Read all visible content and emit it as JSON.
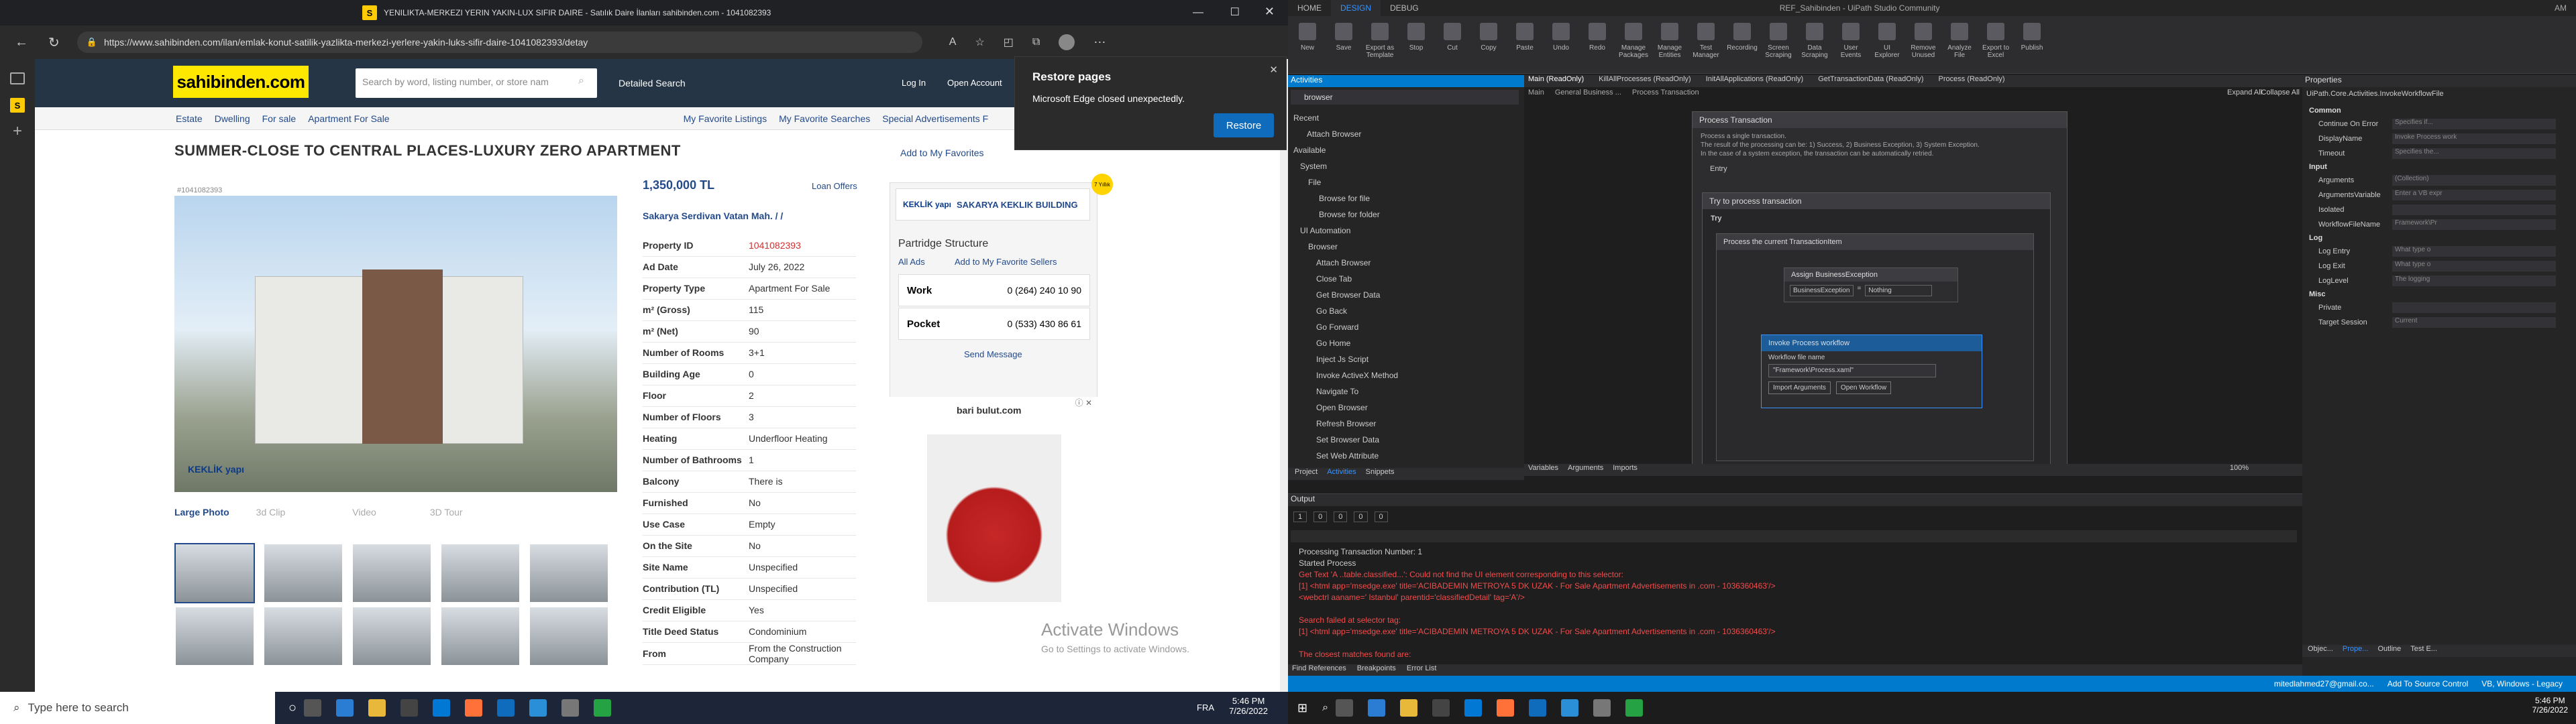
{
  "browser": {
    "tab_title": "YENILIKTA-MERKEZI YERIN YAKIN-LUX SIFIR DAIRE - Satılık Daire İlanları sahibinden.com - 1041082393",
    "url": "https://www.sahibinden.com/ilan/emlak-konut-satilik-yazlikta-merkezi-yerlere-yakin-luks-sifir-daire-1041082393/detay",
    "restore_title": "Restore pages",
    "restore_message": "Microsoft Edge closed unexpectedly.",
    "restore_button": "Restore"
  },
  "site": {
    "logo": "sahibinden.com",
    "search_placeholder": "Search by word, listing number, or store nam",
    "detailed_search": "Detailed Search",
    "login": "Log In",
    "open_account": "Open Account",
    "breadcrumbs": [
      "Estate",
      "Dwelling",
      "For sale",
      "Apartment For Sale"
    ],
    "right_links": [
      "My Favorite Listings",
      "My Favorite Searches",
      "Special Advertisements F"
    ],
    "title": "SUMMER-CLOSE TO CENTRAL PLACES-LUXURY ZERO APARTMENT",
    "add_favorites": "Add to My Favorites",
    "listing_no": "#1041082393",
    "price": "1,350,000 TL",
    "loan_offers": "Loan Offers",
    "location": "Sakarya Serdivan Vatan Mah. / /",
    "details": [
      {
        "k": "Property ID",
        "v": "1041082393"
      },
      {
        "k": "Ad Date",
        "v": "July 26, 2022"
      },
      {
        "k": "Property Type",
        "v": "Apartment For Sale"
      },
      {
        "k": "m² (Gross)",
        "v": "115"
      },
      {
        "k": "m² (Net)",
        "v": "90"
      },
      {
        "k": "Number of Rooms",
        "v": "3+1"
      },
      {
        "k": "Building Age",
        "v": "0"
      },
      {
        "k": "Floor",
        "v": "2"
      },
      {
        "k": "Number of Floors",
        "v": "3"
      },
      {
        "k": "Heating",
        "v": "Underfloor Heating"
      },
      {
        "k": "Number of Bathrooms",
        "v": "1"
      },
      {
        "k": "Balcony",
        "v": "There is"
      },
      {
        "k": "Furnished",
        "v": "No"
      },
      {
        "k": "Use Case",
        "v": "Empty"
      },
      {
        "k": "On the Site",
        "v": "No"
      },
      {
        "k": "Site Name",
        "v": "Unspecified"
      },
      {
        "k": "Contribution (TL)",
        "v": "Unspecified"
      },
      {
        "k": "Credit Eligible",
        "v": "Yes"
      },
      {
        "k": "Title Deed Status",
        "v": "Condominium"
      },
      {
        "k": "From",
        "v": "From the Construction Company"
      }
    ],
    "store_name": "SAKARYA KEKLIK BUILDING",
    "store_logo": "KEKLİK yapı",
    "store_badge": "7 Yıllık",
    "agency": "Partridge Structure",
    "all_ads": "All Ads",
    "add_fav_sellers": "Add to My Favorite Sellers",
    "work_label": "Work",
    "work_phone": "0 (264) 240 10 90",
    "pocket_label": "Pocket",
    "pocket_phone": "0 (533) 430 86 61",
    "send_message": "Send Message",
    "photo_tabs": [
      "Large Photo",
      "3d Clip",
      "Video",
      "3D Tour"
    ],
    "ad_brand": "bari bulut.com",
    "watermark_1": "Activate Windows",
    "watermark_2": "Go to Settings to activate Windows."
  },
  "taskbar_left": {
    "search": "Type here to search",
    "time": "5:46 PM",
    "date": "7/26/2022",
    "lang": "FRA"
  },
  "uipath": {
    "title": "REF_Sahibinden - UiPath Studio Community",
    "tabs": [
      "HOME",
      "DESIGN",
      "DEBUG"
    ],
    "ribbon": [
      "New",
      "Save",
      "Export as Template",
      "Stop",
      "Cut",
      "Copy",
      "Paste",
      "Undo",
      "Redo",
      "Manage Packages",
      "Manage Entities",
      "Test Manager",
      "Recording",
      "Screen Scraping",
      "Data Scraping",
      "User Events",
      "UI Explorer",
      "Remove Unused",
      "Analyze File",
      "Export to Excel",
      "Publish"
    ],
    "activities_title": "Activities",
    "activities_search": "browser",
    "tree": [
      "Recent",
      "Attach Browser",
      "Available",
      "System",
      "File",
      "Browse for file",
      "Browse for folder",
      "UI Automation",
      "Browser",
      "Attach Browser",
      "Close Tab",
      "Get Browser Data",
      "Go Back",
      "Go Forward",
      "Go Home",
      "Inject Js Script",
      "Invoke ActiveX Method",
      "Navigate To",
      "Open Browser",
      "Refresh Browser",
      "Set Browser Data",
      "Set Web Attribute"
    ],
    "doc_tabs": [
      "Main (ReadOnly)",
      "KillAllProcesses (ReadOnly)",
      "InitAllApplications (ReadOnly)",
      "GetTransactionData (ReadOnly)",
      "Process (ReadOnly)"
    ],
    "designer_crumbs": [
      "Main",
      "General Business ...",
      "Process Transaction"
    ],
    "expand_all": "Expand All",
    "collapse_all": "Collapse All",
    "process_transaction": "Process Transaction",
    "pt_desc_1": "Process a single transaction.",
    "pt_desc_2": "The result of the processing can be: 1) Success, 2) Business Exception, 3) System Exception.",
    "pt_desc_3": "In the case of a system exception, the transaction can be automatically retried.",
    "entry": "Entry",
    "try_process": "Try to process transaction",
    "try": "Try",
    "process_current": "Process the current TransactionItem",
    "assign_be": "Assign BusinessException",
    "be_var": "BusinessException",
    "be_val": "Nothing",
    "invoke_title": "Invoke Process workflow",
    "workflow_label": "Workflow file name",
    "workflow_value": "\"Framework\\Process.xaml\"",
    "import_args": "Import Arguments",
    "open_workflow": "Open Workflow",
    "designer_bottom": [
      "Variables",
      "Arguments",
      "Imports"
    ],
    "zoom": "100%",
    "left_bottom_tabs": [
      "Project",
      "Activities",
      "Snippets"
    ],
    "output_title": "Output",
    "output_counts": [
      "1",
      "0",
      "0",
      "0",
      "0"
    ],
    "output_lines": [
      {
        "t": "Processing Transaction Number: 1",
        "c": "#ccc"
      },
      {
        "t": "Started Process",
        "c": "#ccc"
      },
      {
        "t": "Get Text 'A ..table.classified...': Could not find the UI element corresponding to this selector:",
        "c": "#f14c4c"
      },
      {
        "t": "[1] <html app='msedge.exe' title='ACIBADEMIN METROYA 5 DK UZAK - For Sale Apartment Advertisements in .com - 1036360463'/>",
        "c": "#f14c4c"
      },
      {
        "t": "<webctrl aaname=' Istanbul' parentid='classifiedDetail' tag='A'/>",
        "c": "#f14c4c"
      },
      {
        "t": "",
        "c": "#ccc"
      },
      {
        "t": "Search failed at selector tag:",
        "c": "#f14c4c"
      },
      {
        "t": "[1] <html app='msedge.exe' title='ACIBADEMIN METROYA 5 DK UZAK - For Sale Apartment Advertisements in .com - 1036360463'/>",
        "c": "#f14c4c"
      },
      {
        "t": "",
        "c": "#ccc"
      },
      {
        "t": "The closest matches found are:",
        "c": "#f14c4c"
      }
    ],
    "output_tabs": [
      "Find References",
      "Breakpoints",
      "Error List"
    ],
    "properties_title": "Properties",
    "properties_type": "UiPath.Core.Activities.InvokeWorkflowFile",
    "prop_groups": [
      {
        "name": "Common",
        "rows": [
          {
            "k": "Continue On Error",
            "v": "Specifies if..."
          },
          {
            "k": "DisplayName",
            "v": "Invoke Process work"
          },
          {
            "k": "Timeout",
            "v": "Specifies the..."
          }
        ]
      },
      {
        "name": "Input",
        "rows": [
          {
            "k": "Arguments",
            "v": "(Collection)"
          },
          {
            "k": "ArgumentsVariable",
            "v": "Enter a VB expr"
          },
          {
            "k": "Isolated",
            "v": ""
          },
          {
            "k": "WorkflowFileName",
            "v": "Framework\\Pr"
          }
        ]
      },
      {
        "name": "Log",
        "rows": [
          {
            "k": "Log Entry",
            "v": "What type o"
          },
          {
            "k": "Log Exit",
            "v": "What type o"
          },
          {
            "k": "LogLevel",
            "v": "The logging"
          }
        ]
      },
      {
        "name": "Misc",
        "rows": [
          {
            "k": "Private",
            "v": ""
          },
          {
            "k": "Target Session",
            "v": "Current"
          }
        ]
      }
    ],
    "prop_bottom_tabs": [
      "Objec...",
      "Prope...",
      "Outline",
      "Test E..."
    ],
    "status": {
      "user": "mitedlahmed27@gmail.co...",
      "source": "Add To Source Control",
      "mode": "VB, Windows - Legacy"
    },
    "time": "5:46 PM",
    "date": "7/26/2022",
    "am": "AM"
  }
}
